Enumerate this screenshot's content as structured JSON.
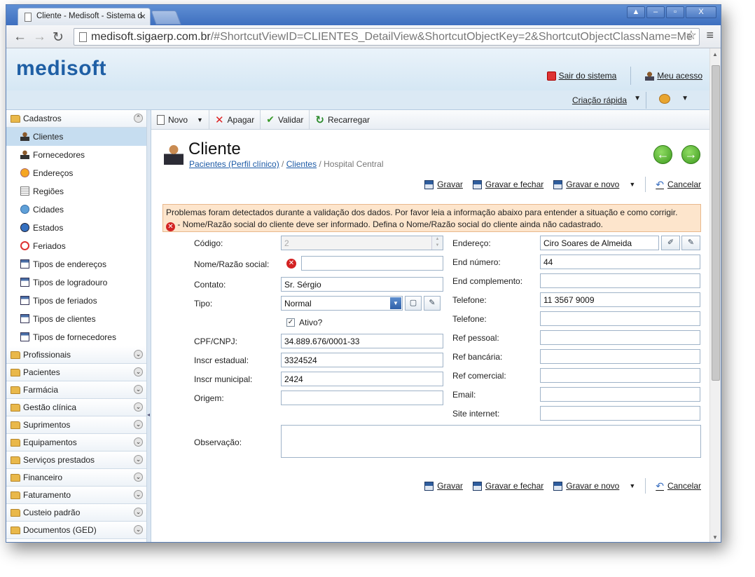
{
  "browser": {
    "tab_title": "Cliente - Medisoft - Sistema d",
    "url_host": "medisoft.sigaerp.com.br",
    "url_path": "/#ShortcutViewID=CLIENTES_DetailView&ShortcutObjectKey=2&ShortcutObjectClassName=Me"
  },
  "header": {
    "logo": "medisoft",
    "logout": "Sair do sistema",
    "my_access": "Meu acesso",
    "quick_create": "Criação rápida"
  },
  "sidebar": {
    "groups": [
      {
        "label": "Cadastros",
        "items": [
          {
            "label": "Clientes",
            "icon": "person-icon",
            "selected": true
          },
          {
            "label": "Fornecedores",
            "icon": "person-icon"
          },
          {
            "label": "Endereços",
            "icon": "compass-icon"
          },
          {
            "label": "Regiões",
            "icon": "list-icon"
          },
          {
            "label": "Cidades",
            "icon": "globe-icon"
          },
          {
            "label": "Estados",
            "icon": "ball-icon"
          },
          {
            "label": "Feriados",
            "icon": "ban-icon"
          },
          {
            "label": "Tipos de endereços",
            "icon": "window-icon"
          },
          {
            "label": "Tipos de logradouro",
            "icon": "window-icon"
          },
          {
            "label": "Tipos de feriados",
            "icon": "window-icon"
          },
          {
            "label": "Tipos de clientes",
            "icon": "window-icon"
          },
          {
            "label": "Tipos de fornecedores",
            "icon": "window-icon"
          }
        ]
      },
      {
        "label": "Profissionais"
      },
      {
        "label": "Pacientes"
      },
      {
        "label": "Farmácia"
      },
      {
        "label": "Gestão clínica"
      },
      {
        "label": "Suprimentos"
      },
      {
        "label": "Equipamentos"
      },
      {
        "label": "Serviços prestados"
      },
      {
        "label": "Financeiro"
      },
      {
        "label": "Faturamento"
      },
      {
        "label": "Custeio padrão"
      },
      {
        "label": "Documentos (GED)"
      }
    ]
  },
  "toolbar": {
    "new": "Novo",
    "delete": "Apagar",
    "validate": "Validar",
    "reload": "Recarregar"
  },
  "page": {
    "title": "Cliente",
    "breadcrumb": [
      "Pacientes (Perfil clínico)",
      "Clientes",
      "Hospital Central"
    ],
    "actions": {
      "save": "Gravar",
      "save_close": "Gravar e fechar",
      "save_new": "Gravar e novo",
      "cancel": "Cancelar"
    }
  },
  "error": {
    "line1": "Problemas foram detectados durante a validação dos dados. Por favor leia a informação abaixo para entender a situação e como corrigir.",
    "line2": " - Nome/Razão social do cliente deve ser informado. Defina o Nome/Razão social do cliente ainda não cadastrado."
  },
  "form": {
    "codigo": {
      "label": "Código:",
      "value": "2"
    },
    "nome": {
      "label": "Nome/Razão social:",
      "value": ""
    },
    "contato": {
      "label": "Contato:",
      "value": "Sr. Sérgio"
    },
    "tipo": {
      "label": "Tipo:",
      "value": "Normal"
    },
    "ativo": {
      "label": "Ativo?",
      "checked": true
    },
    "cpf": {
      "label": "CPF/CNPJ:",
      "value": "34.889.676/0001-33"
    },
    "inscr_estadual": {
      "label": "Inscr estadual:",
      "value": "3324524"
    },
    "inscr_municipal": {
      "label": "Inscr municipal:",
      "value": "2424"
    },
    "origem": {
      "label": "Origem:",
      "value": ""
    },
    "observacao": {
      "label": "Observação:",
      "value": ""
    },
    "endereco": {
      "label": "Endereço:",
      "value": "Ciro Soares de Almeida"
    },
    "end_numero": {
      "label": "End número:",
      "value": "44"
    },
    "end_complemento": {
      "label": "End complemento:",
      "value": ""
    },
    "telefone1": {
      "label": "Telefone:",
      "value": "11 3567 9009"
    },
    "telefone2": {
      "label": "Telefone:",
      "value": ""
    },
    "ref_pessoal": {
      "label": "Ref pessoal:",
      "value": ""
    },
    "ref_bancaria": {
      "label": "Ref bancária:",
      "value": ""
    },
    "ref_comercial": {
      "label": "Ref comercial:",
      "value": ""
    },
    "email": {
      "label": "Email:",
      "value": ""
    },
    "site": {
      "label": "Site internet:",
      "value": ""
    }
  }
}
